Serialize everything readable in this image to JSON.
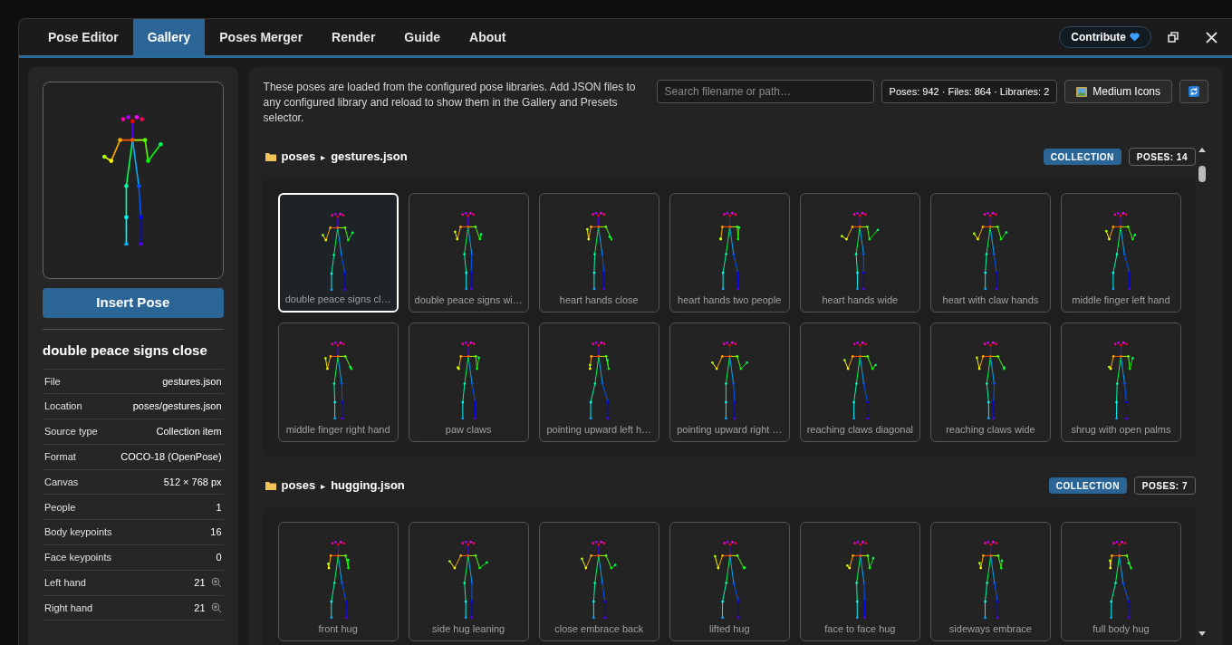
{
  "tabs": [
    {
      "label": "Pose Editor",
      "selected": false
    },
    {
      "label": "Gallery",
      "selected": true
    },
    {
      "label": "Poses Merger",
      "selected": false
    },
    {
      "label": "Render",
      "selected": false
    },
    {
      "label": "Guide",
      "selected": false
    },
    {
      "label": "About",
      "selected": false
    }
  ],
  "contribute_button": "Contribute",
  "preview": {
    "insert_button": "Insert Pose",
    "title": "double peace signs close",
    "details": [
      {
        "label": "File",
        "value": "gestures.json",
        "zoom": false
      },
      {
        "label": "Location",
        "value": "poses/gestures.json",
        "zoom": false
      },
      {
        "label": "Source type",
        "value": "Collection item",
        "zoom": false
      },
      {
        "label": "Format",
        "value": "COCO-18 (OpenPose)",
        "zoom": false
      },
      {
        "label": "Canvas",
        "value": "512 × 768 px",
        "zoom": false
      },
      {
        "label": "People",
        "value": "1",
        "zoom": false
      },
      {
        "label": "Body keypoints",
        "value": "16",
        "zoom": false
      },
      {
        "label": "Face keypoints",
        "value": "0",
        "zoom": false
      },
      {
        "label": "Left hand",
        "value": "21",
        "zoom": true
      },
      {
        "label": "Right hand",
        "value": "21",
        "zoom": true
      }
    ]
  },
  "gallery": {
    "description": "These poses are loaded from the configured pose libraries. Add JSON files to any configured library and reload to show them in the Gallery and Presets selector.",
    "search": {
      "placeholder": "Search filename or path…"
    },
    "stats": "Poses: 942 · Files: 864 · Libraries: 2",
    "size_button": "Medium Icons",
    "sections": [
      {
        "folder": "poses",
        "separator": "▸",
        "file": "gestures.json",
        "badge": "COLLECTION",
        "count": "POSES: 14",
        "items": [
          {
            "label": "double peace signs cl…",
            "selected": true
          },
          {
            "label": "double peace signs wi…",
            "selected": false
          },
          {
            "label": "heart hands close",
            "selected": false
          },
          {
            "label": "heart hands two people",
            "selected": false
          },
          {
            "label": "heart hands wide",
            "selected": false
          },
          {
            "label": "heart with claw hands",
            "selected": false
          },
          {
            "label": "middle finger left hand",
            "selected": false
          },
          {
            "label": "middle finger right hand",
            "selected": false
          },
          {
            "label": "paw claws",
            "selected": false
          },
          {
            "label": "pointing upward left h…",
            "selected": false
          },
          {
            "label": "pointing upward right …",
            "selected": false
          },
          {
            "label": "reaching claws diagonal",
            "selected": false
          },
          {
            "label": "reaching claws wide",
            "selected": false
          },
          {
            "label": "shrug with open palms",
            "selected": false
          }
        ]
      },
      {
        "folder": "poses",
        "separator": "▸",
        "file": "hugging.json",
        "badge": "COLLECTION",
        "count": "POSES: 7",
        "items": [
          {
            "label": "front hug",
            "selected": false
          },
          {
            "label": "side hug leaning",
            "selected": false
          },
          {
            "label": "close embrace back",
            "selected": false
          },
          {
            "label": "lifted hug",
            "selected": false
          },
          {
            "label": "face to face hug",
            "selected": false
          },
          {
            "label": "sideways embrace",
            "selected": false
          },
          {
            "label": "full body hug",
            "selected": false
          }
        ]
      }
    ]
  }
}
